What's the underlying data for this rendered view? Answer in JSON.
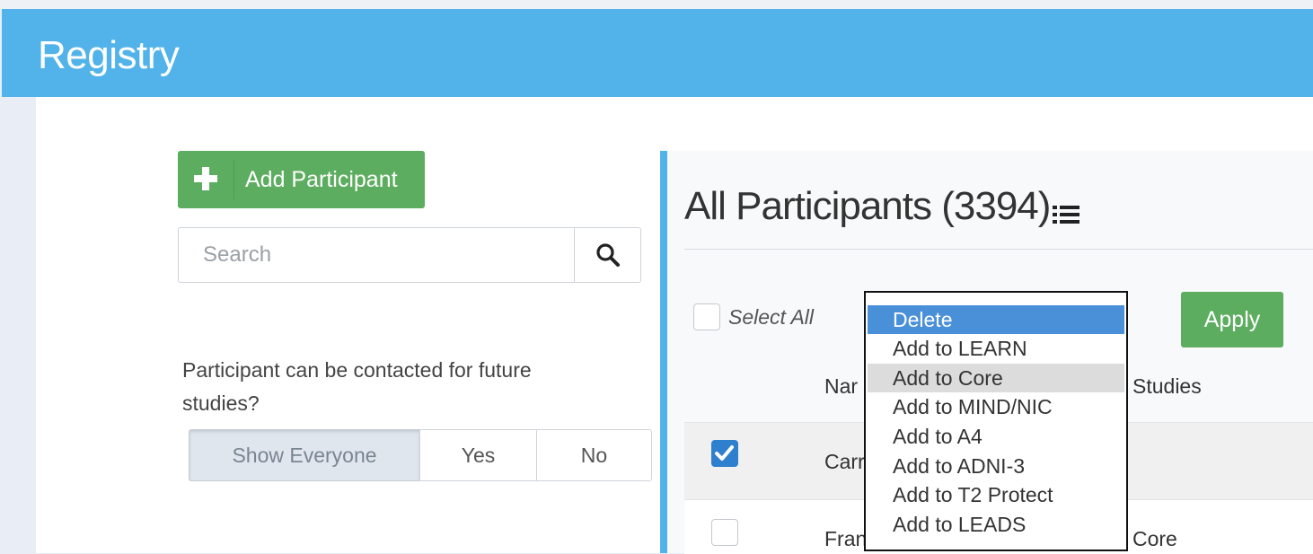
{
  "header": {
    "title": "Registry"
  },
  "left": {
    "add_participant_label": "Add Participant",
    "search": {
      "placeholder": "Search",
      "value": ""
    },
    "contact_question": "Participant can be contacted for future studies?",
    "contact_filter": {
      "options": [
        "Show Everyone",
        "Yes",
        "No"
      ],
      "selected": "Show Everyone"
    }
  },
  "panel": {
    "title": "All Participants (3394)",
    "select_all_label": "Select All",
    "apply_label": "Apply",
    "bulk_action": {
      "selected": "Delete",
      "hovered": "Add to Core",
      "options": [
        "Delete",
        "Add to LEARN",
        "Add to Core",
        "Add to MIND/NIC",
        "Add to A4",
        "Add to ADNI-3",
        "Add to T2 Protect",
        "Add to LEADS"
      ]
    },
    "columns": {
      "name": "Nar",
      "studies": "Studies"
    },
    "rows": [
      {
        "name": "Carr",
        "studies": "",
        "checked": true
      },
      {
        "name": "Fran",
        "studies": "Core",
        "checked": false
      }
    ]
  },
  "colors": {
    "header": "#52b3ea",
    "button_green": "#5cad5f",
    "selected_option": "#4a90d9"
  },
  "icons": {
    "add": "plus-icon",
    "search": "search-icon",
    "view": "list-icon",
    "check": "check-icon"
  }
}
